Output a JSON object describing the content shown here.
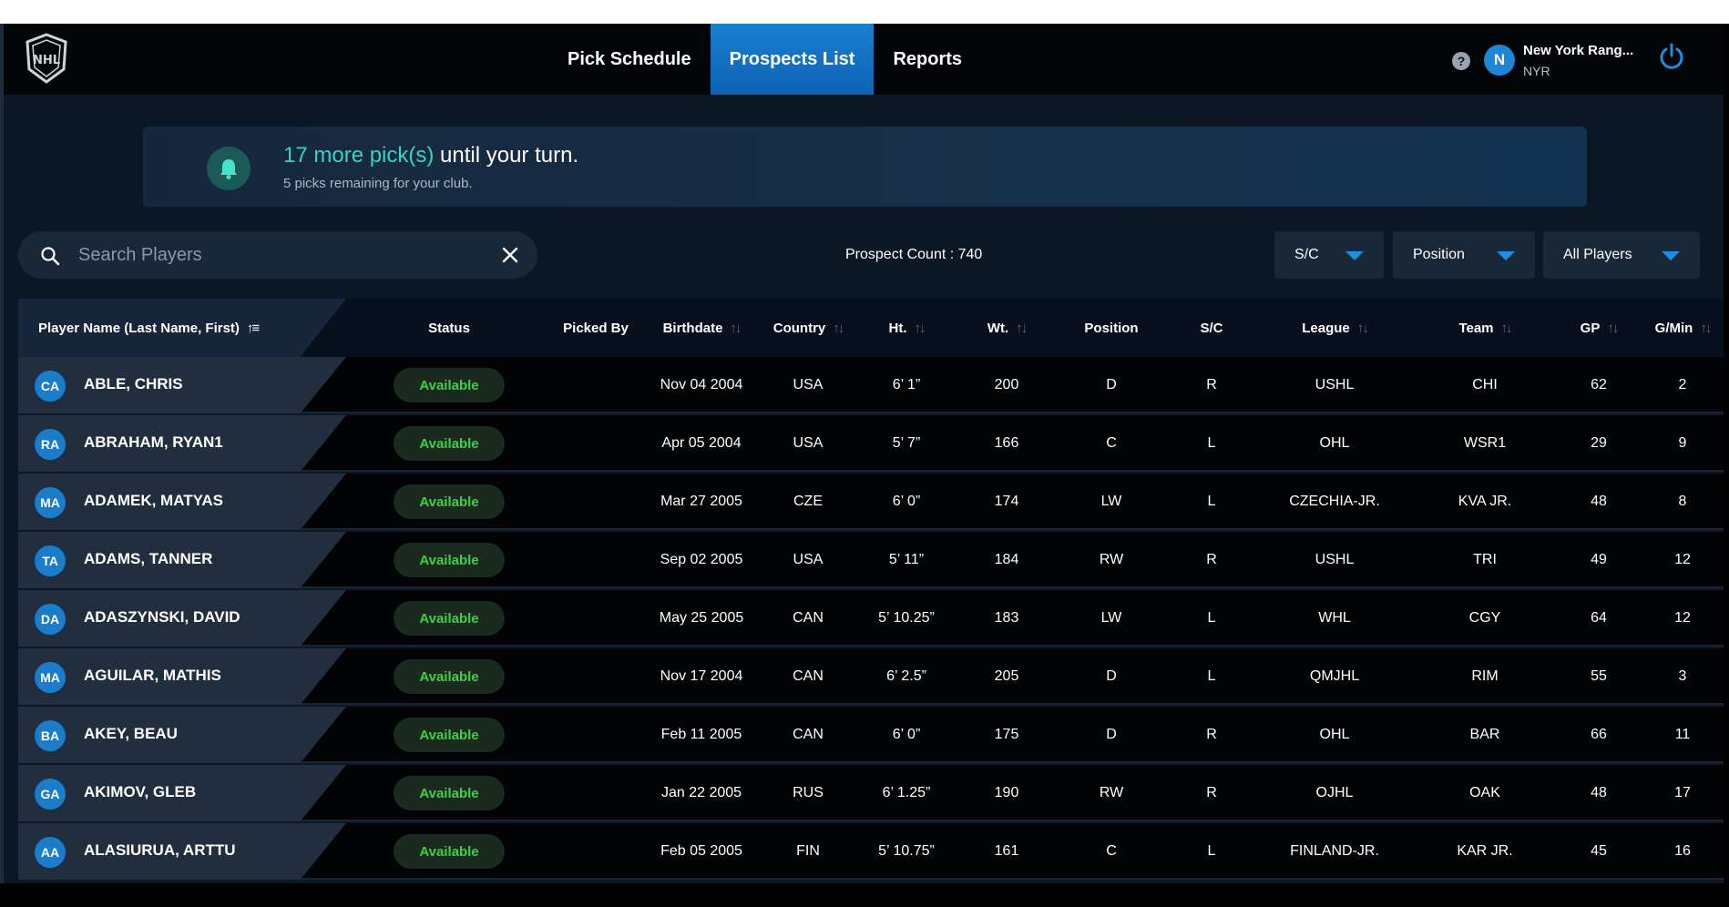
{
  "header": {
    "nav": [
      {
        "label": "Pick Schedule",
        "active": false
      },
      {
        "label": "Prospects List",
        "active": true
      },
      {
        "label": "Reports",
        "active": false
      }
    ],
    "help_icon": "?",
    "user": {
      "initial": "N",
      "name": "New York Rang...",
      "club": "NYR"
    }
  },
  "notice": {
    "picks_accent": "17 more pick(s)",
    "picks_rest": " until your turn.",
    "subtext": "5 picks remaining for your club."
  },
  "toolbar": {
    "search_placeholder": "Search Players",
    "search_value": "",
    "prospect_count": "Prospect Count : 740",
    "filters": [
      {
        "label": "S/C"
      },
      {
        "label": "Position"
      },
      {
        "label": "All Players"
      }
    ]
  },
  "table": {
    "headers": {
      "name": "Player Name (Last Name, First)",
      "status": "Status",
      "picked_by": "Picked By",
      "birthdate": "Birthdate",
      "country": "Country",
      "ht": "Ht.",
      "wt": "Wt.",
      "position": "Position",
      "sc": "S/C",
      "league": "League",
      "team": "Team",
      "gp": "GP",
      "gmin": "G/Min"
    },
    "rows": [
      {
        "initials": "CA",
        "name": "ABLE, CHRIS",
        "status": "Available",
        "picked_by": "",
        "birthdate": "Nov 04 2004",
        "country": "USA",
        "ht": "6’ 1”",
        "wt": "200",
        "position": "D",
        "sc": "R",
        "league": "USHL",
        "team": "CHI",
        "gp": "62",
        "gmin": "2"
      },
      {
        "initials": "RA",
        "name": "ABRAHAM, RYAN1",
        "status": "Available",
        "picked_by": "",
        "birthdate": "Apr 05 2004",
        "country": "USA",
        "ht": "5’ 7”",
        "wt": "166",
        "position": "C",
        "sc": "L",
        "league": "OHL",
        "team": "WSR1",
        "gp": "29",
        "gmin": "9"
      },
      {
        "initials": "MA",
        "name": "ADAMEK, MATYAS",
        "status": "Available",
        "picked_by": "",
        "birthdate": "Mar 27 2005",
        "country": "CZE",
        "ht": "6’ 0”",
        "wt": "174",
        "position": "LW",
        "sc": "L",
        "league": "CZECHIA-JR.",
        "team": "KVA JR.",
        "gp": "48",
        "gmin": "8"
      },
      {
        "initials": "TA",
        "name": "ADAMS, TANNER",
        "status": "Available",
        "picked_by": "",
        "birthdate": "Sep 02 2005",
        "country": "USA",
        "ht": "5’ 11”",
        "wt": "184",
        "position": "RW",
        "sc": "R",
        "league": "USHL",
        "team": "TRI",
        "gp": "49",
        "gmin": "12"
      },
      {
        "initials": "DA",
        "name": "ADASZYNSKI, DAVID",
        "status": "Available",
        "picked_by": "",
        "birthdate": "May 25 2005",
        "country": "CAN",
        "ht": "5’ 10.25”",
        "wt": "183",
        "position": "LW",
        "sc": "L",
        "league": "WHL",
        "team": "CGY",
        "gp": "64",
        "gmin": "12"
      },
      {
        "initials": "MA",
        "name": "AGUILAR, MATHIS",
        "status": "Available",
        "picked_by": "",
        "birthdate": "Nov 17 2004",
        "country": "CAN",
        "ht": "6’ 2.5”",
        "wt": "205",
        "position": "D",
        "sc": "L",
        "league": "QMJHL",
        "team": "RIM",
        "gp": "55",
        "gmin": "3"
      },
      {
        "initials": "BA",
        "name": "AKEY, BEAU",
        "status": "Available",
        "picked_by": "",
        "birthdate": "Feb 11 2005",
        "country": "CAN",
        "ht": "6’ 0”",
        "wt": "175",
        "position": "D",
        "sc": "R",
        "league": "OHL",
        "team": "BAR",
        "gp": "66",
        "gmin": "11"
      },
      {
        "initials": "GA",
        "name": "AKIMOV, GLEB",
        "status": "Available",
        "picked_by": "",
        "birthdate": "Jan 22 2005",
        "country": "RUS",
        "ht": "6’ 1.25”",
        "wt": "190",
        "position": "RW",
        "sc": "R",
        "league": "OJHL",
        "team": "OAK",
        "gp": "48",
        "gmin": "17"
      },
      {
        "initials": "AA",
        "name": "ALASIURUA, ARTTU",
        "status": "Available",
        "picked_by": "",
        "birthdate": "Feb 05 2005",
        "country": "FIN",
        "ht": "5’ 10.75”",
        "wt": "161",
        "position": "C",
        "sc": "L",
        "league": "FINLAND-JR.",
        "team": "KAR JR.",
        "gp": "45",
        "gmin": "16"
      }
    ]
  },
  "colors": {
    "accent_blue": "#1a7fd0",
    "status_green": "#3fcf47",
    "notice_accent": "#37d3c1"
  }
}
